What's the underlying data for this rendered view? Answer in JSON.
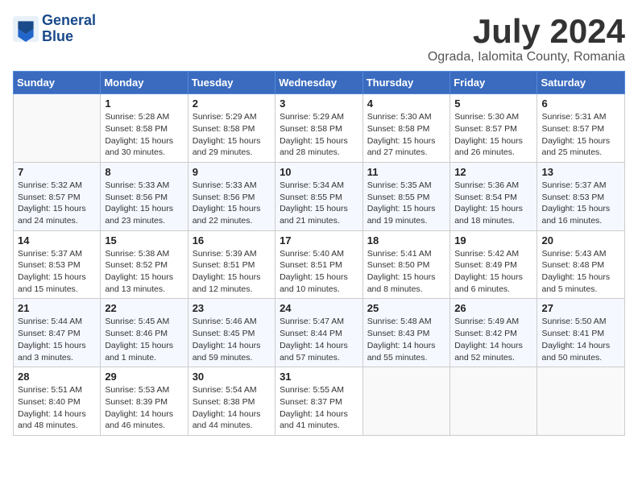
{
  "header": {
    "logo_line1": "General",
    "logo_line2": "Blue",
    "month_year": "July 2024",
    "location": "Ograda, Ialomita County, Romania"
  },
  "weekdays": [
    "Sunday",
    "Monday",
    "Tuesday",
    "Wednesday",
    "Thursday",
    "Friday",
    "Saturday"
  ],
  "weeks": [
    [
      {
        "day": "",
        "info": ""
      },
      {
        "day": "1",
        "info": "Sunrise: 5:28 AM\nSunset: 8:58 PM\nDaylight: 15 hours\nand 30 minutes."
      },
      {
        "day": "2",
        "info": "Sunrise: 5:29 AM\nSunset: 8:58 PM\nDaylight: 15 hours\nand 29 minutes."
      },
      {
        "day": "3",
        "info": "Sunrise: 5:29 AM\nSunset: 8:58 PM\nDaylight: 15 hours\nand 28 minutes."
      },
      {
        "day": "4",
        "info": "Sunrise: 5:30 AM\nSunset: 8:58 PM\nDaylight: 15 hours\nand 27 minutes."
      },
      {
        "day": "5",
        "info": "Sunrise: 5:30 AM\nSunset: 8:57 PM\nDaylight: 15 hours\nand 26 minutes."
      },
      {
        "day": "6",
        "info": "Sunrise: 5:31 AM\nSunset: 8:57 PM\nDaylight: 15 hours\nand 25 minutes."
      }
    ],
    [
      {
        "day": "7",
        "info": "Sunrise: 5:32 AM\nSunset: 8:57 PM\nDaylight: 15 hours\nand 24 minutes."
      },
      {
        "day": "8",
        "info": "Sunrise: 5:33 AM\nSunset: 8:56 PM\nDaylight: 15 hours\nand 23 minutes."
      },
      {
        "day": "9",
        "info": "Sunrise: 5:33 AM\nSunset: 8:56 PM\nDaylight: 15 hours\nand 22 minutes."
      },
      {
        "day": "10",
        "info": "Sunrise: 5:34 AM\nSunset: 8:55 PM\nDaylight: 15 hours\nand 21 minutes."
      },
      {
        "day": "11",
        "info": "Sunrise: 5:35 AM\nSunset: 8:55 PM\nDaylight: 15 hours\nand 19 minutes."
      },
      {
        "day": "12",
        "info": "Sunrise: 5:36 AM\nSunset: 8:54 PM\nDaylight: 15 hours\nand 18 minutes."
      },
      {
        "day": "13",
        "info": "Sunrise: 5:37 AM\nSunset: 8:53 PM\nDaylight: 15 hours\nand 16 minutes."
      }
    ],
    [
      {
        "day": "14",
        "info": "Sunrise: 5:37 AM\nSunset: 8:53 PM\nDaylight: 15 hours\nand 15 minutes."
      },
      {
        "day": "15",
        "info": "Sunrise: 5:38 AM\nSunset: 8:52 PM\nDaylight: 15 hours\nand 13 minutes."
      },
      {
        "day": "16",
        "info": "Sunrise: 5:39 AM\nSunset: 8:51 PM\nDaylight: 15 hours\nand 12 minutes."
      },
      {
        "day": "17",
        "info": "Sunrise: 5:40 AM\nSunset: 8:51 PM\nDaylight: 15 hours\nand 10 minutes."
      },
      {
        "day": "18",
        "info": "Sunrise: 5:41 AM\nSunset: 8:50 PM\nDaylight: 15 hours\nand 8 minutes."
      },
      {
        "day": "19",
        "info": "Sunrise: 5:42 AM\nSunset: 8:49 PM\nDaylight: 15 hours\nand 6 minutes."
      },
      {
        "day": "20",
        "info": "Sunrise: 5:43 AM\nSunset: 8:48 PM\nDaylight: 15 hours\nand 5 minutes."
      }
    ],
    [
      {
        "day": "21",
        "info": "Sunrise: 5:44 AM\nSunset: 8:47 PM\nDaylight: 15 hours\nand 3 minutes."
      },
      {
        "day": "22",
        "info": "Sunrise: 5:45 AM\nSunset: 8:46 PM\nDaylight: 15 hours\nand 1 minute."
      },
      {
        "day": "23",
        "info": "Sunrise: 5:46 AM\nSunset: 8:45 PM\nDaylight: 14 hours\nand 59 minutes."
      },
      {
        "day": "24",
        "info": "Sunrise: 5:47 AM\nSunset: 8:44 PM\nDaylight: 14 hours\nand 57 minutes."
      },
      {
        "day": "25",
        "info": "Sunrise: 5:48 AM\nSunset: 8:43 PM\nDaylight: 14 hours\nand 55 minutes."
      },
      {
        "day": "26",
        "info": "Sunrise: 5:49 AM\nSunset: 8:42 PM\nDaylight: 14 hours\nand 52 minutes."
      },
      {
        "day": "27",
        "info": "Sunrise: 5:50 AM\nSunset: 8:41 PM\nDaylight: 14 hours\nand 50 minutes."
      }
    ],
    [
      {
        "day": "28",
        "info": "Sunrise: 5:51 AM\nSunset: 8:40 PM\nDaylight: 14 hours\nand 48 minutes."
      },
      {
        "day": "29",
        "info": "Sunrise: 5:53 AM\nSunset: 8:39 PM\nDaylight: 14 hours\nand 46 minutes."
      },
      {
        "day": "30",
        "info": "Sunrise: 5:54 AM\nSunset: 8:38 PM\nDaylight: 14 hours\nand 44 minutes."
      },
      {
        "day": "31",
        "info": "Sunrise: 5:55 AM\nSunset: 8:37 PM\nDaylight: 14 hours\nand 41 minutes."
      },
      {
        "day": "",
        "info": ""
      },
      {
        "day": "",
        "info": ""
      },
      {
        "day": "",
        "info": ""
      }
    ]
  ]
}
